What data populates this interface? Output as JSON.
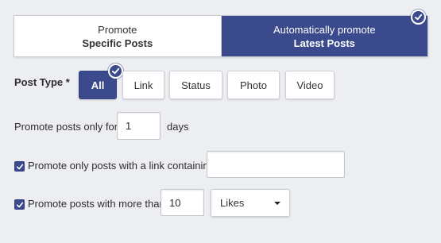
{
  "mode": {
    "specific": {
      "line1": "Promote",
      "line2": "Specific Posts",
      "selected": false
    },
    "latest": {
      "line1": "Automatically promote",
      "line2": "Latest Posts",
      "selected": true
    }
  },
  "post_type": {
    "label": "Post Type *",
    "options": [
      {
        "label": "All",
        "selected": true
      },
      {
        "label": "Link",
        "selected": false
      },
      {
        "label": "Status",
        "selected": false
      },
      {
        "label": "Photo",
        "selected": false
      },
      {
        "label": "Video",
        "selected": false
      }
    ]
  },
  "days_row": {
    "prefix": "Promote posts only for",
    "value": "1",
    "suffix": "days"
  },
  "link_row": {
    "checked": true,
    "label": "Promote only posts with a link containing:",
    "value": ""
  },
  "more_row": {
    "checked": true,
    "label": "Promote posts with more than",
    "value": "10",
    "metric": "Likes"
  },
  "colors": {
    "accent": "#3b4a8c",
    "background": "#eceef1"
  }
}
